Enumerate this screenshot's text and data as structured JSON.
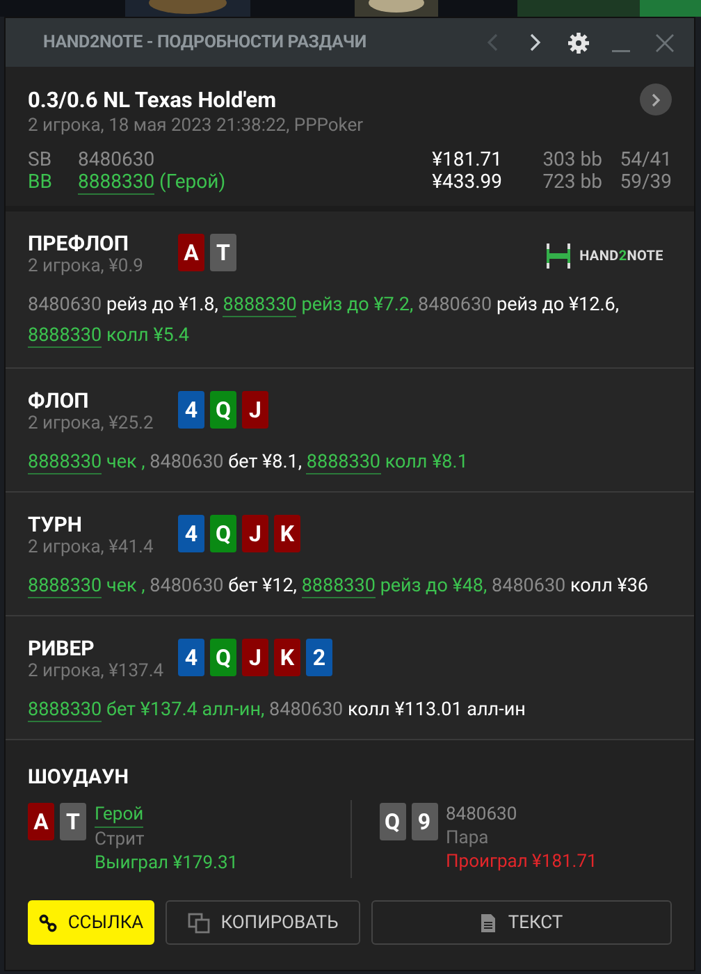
{
  "window": {
    "title": "HAND2NOTE - ПОДРОБНОСТИ РАЗДАЧИ",
    "nav": [
      {
        "kind": "prev",
        "disabled": true
      },
      {
        "kind": "next",
        "disabled": false
      }
    ]
  },
  "hand": {
    "title": "0.3/0.6 NL Texas Hold'em",
    "subtitle": "2 игрока, 18 мая 2023 21:38:22, PPPoker",
    "players": [
      {
        "position": "SB",
        "name": "8480630",
        "hero": false,
        "stack": "¥181.71",
        "bb": "303 bb",
        "stats": "54/41"
      },
      {
        "position": "BB",
        "name": "8888330",
        "hero": true,
        "suffix": "(Герой)",
        "stack": "¥433.99",
        "bb": "723 bb",
        "stats": "59/39"
      }
    ]
  },
  "streets": [
    {
      "name": "ПРЕФЛОП",
      "info": "2 игрока, ¥0.9",
      "logo": {
        "text_a": "HAND",
        "text_b": "2",
        "text_c": "NOTE"
      },
      "cards": [
        {
          "rank": "A",
          "color": "#8b0000"
        },
        {
          "rank": "T",
          "color": "#5a5a5a"
        }
      ],
      "actions": [
        {
          "player": "8480630",
          "hero": false,
          "text": "рейз до ¥1.8,"
        },
        {
          "player": "8888330",
          "hero": true,
          "text": "рейз до ¥7.2,"
        },
        {
          "player": "8480630",
          "hero": false,
          "text": "рейз до ¥12.6,"
        },
        {
          "player": "8888330",
          "hero": true,
          "text": "колл ¥5.4"
        }
      ]
    },
    {
      "name": "ФЛОП",
      "info": "2 игрока, ¥25.2",
      "cards": [
        {
          "rank": "4",
          "color": "#0b57a8"
        },
        {
          "rank": "Q",
          "color": "#0a8a14"
        },
        {
          "rank": "J",
          "color": "#8b0000"
        }
      ],
      "actions": [
        {
          "player": "8888330",
          "hero": true,
          "text": "чек ,"
        },
        {
          "player": "8480630",
          "hero": false,
          "text": "бет ¥8.1,"
        },
        {
          "player": "8888330",
          "hero": true,
          "text": "колл ¥8.1"
        }
      ]
    },
    {
      "name": "ТУРН",
      "info": "2 игрока, ¥41.4",
      "cards": [
        {
          "rank": "4",
          "color": "#0b57a8"
        },
        {
          "rank": "Q",
          "color": "#0a8a14"
        },
        {
          "rank": "J",
          "color": "#8b0000"
        },
        {
          "rank": "K",
          "color": "#8b0000"
        }
      ],
      "actions": [
        {
          "player": "8888330",
          "hero": true,
          "text": "чек ,"
        },
        {
          "player": "8480630",
          "hero": false,
          "text": "бет ¥12,"
        },
        {
          "player": "8888330",
          "hero": true,
          "text": "рейз до ¥48,"
        },
        {
          "player": "8480630",
          "hero": false,
          "text": "колл ¥36"
        }
      ]
    },
    {
      "name": "РИВЕР",
      "info": "2 игрока, ¥137.4",
      "cards": [
        {
          "rank": "4",
          "color": "#0b57a8"
        },
        {
          "rank": "Q",
          "color": "#0a8a14"
        },
        {
          "rank": "J",
          "color": "#8b0000"
        },
        {
          "rank": "K",
          "color": "#8b0000"
        },
        {
          "rank": "2",
          "color": "#0b57a8"
        }
      ],
      "actions": [
        {
          "player": "8888330",
          "hero": true,
          "text": "бет ¥137.4 алл-ин,"
        },
        {
          "player": "8480630",
          "hero": false,
          "text": "колл ¥113.01 алл-ин"
        }
      ]
    }
  ],
  "showdown": {
    "title": "ШОУДАУН",
    "players": [
      {
        "name": "Герой",
        "hero": true,
        "hand": "Стрит",
        "result": "Выиграл ¥179.31",
        "won": true,
        "cards": [
          {
            "rank": "A",
            "color": "#8b0000"
          },
          {
            "rank": "T",
            "color": "#5a5a5a"
          }
        ]
      },
      {
        "name": "8480630",
        "hero": false,
        "hand": "Пара",
        "result": "Проиграл ¥181.71",
        "won": false,
        "cards": [
          {
            "rank": "Q",
            "color": "#5a5a5a"
          },
          {
            "rank": "9",
            "color": "#5a5a5a"
          }
        ]
      }
    ]
  },
  "buttons": [
    {
      "label": "ССЫЛКА",
      "kind": "link"
    },
    {
      "label": "КОПИРОВАТЬ",
      "kind": "copy"
    },
    {
      "label": "ТЕКСТ",
      "kind": "text"
    }
  ]
}
